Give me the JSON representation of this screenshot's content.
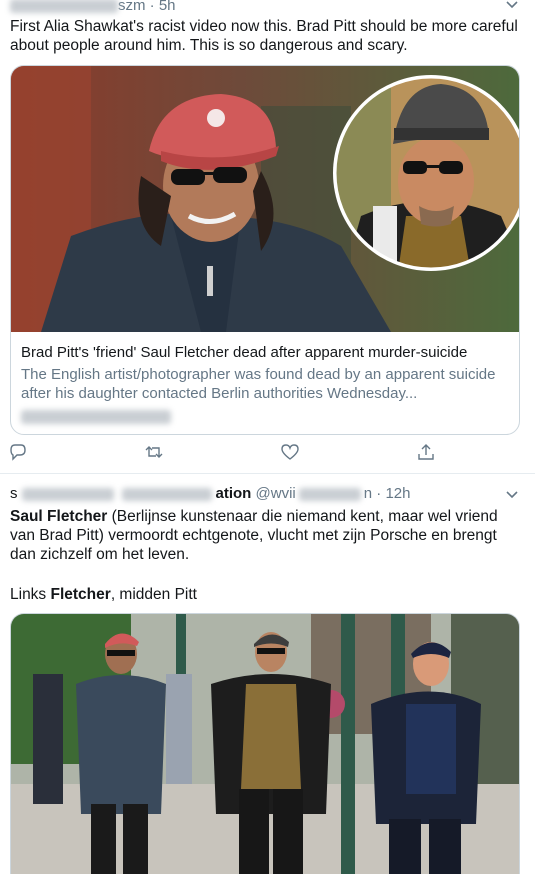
{
  "tweet1": {
    "handle_suffix": "szm",
    "time": "5h",
    "text": "First Alia Shawkat's racist video now this. Brad Pitt should be more careful about people around him. This is so dangerous and scary.",
    "card": {
      "title": "Brad Pitt's 'friend' Saul Fletcher dead after apparent murder-suicide",
      "description": "The English artist/photographer was found dead by an apparent suicide after his daughter contacted Berlin authorities Wednesday..."
    },
    "icons": [
      "reply-icon",
      "retweet-icon",
      "like-icon",
      "share-icon",
      "chevron-down-icon"
    ]
  },
  "tweet2": {
    "name_fragment_1": "s",
    "name_fragment_2": "ation",
    "handle_fragment": "@wvii",
    "handle_end": "n",
    "time": "12h",
    "text_name": "Saul Fletcher",
    "text_rest": " (Berlijnse kunstenaar die niemand kent, maar wel vriend van Brad Pitt) vermoordt echtgenote, vlucht met zijn Porsche en brengt dan zichzelf om het leven.",
    "links_prefix": "Links ",
    "links_name": "Fletcher",
    "links_suffix": ", midden Pitt"
  },
  "colors": {
    "text": "#14171a",
    "secondary": "#657786",
    "border": "#ccd6dd"
  }
}
